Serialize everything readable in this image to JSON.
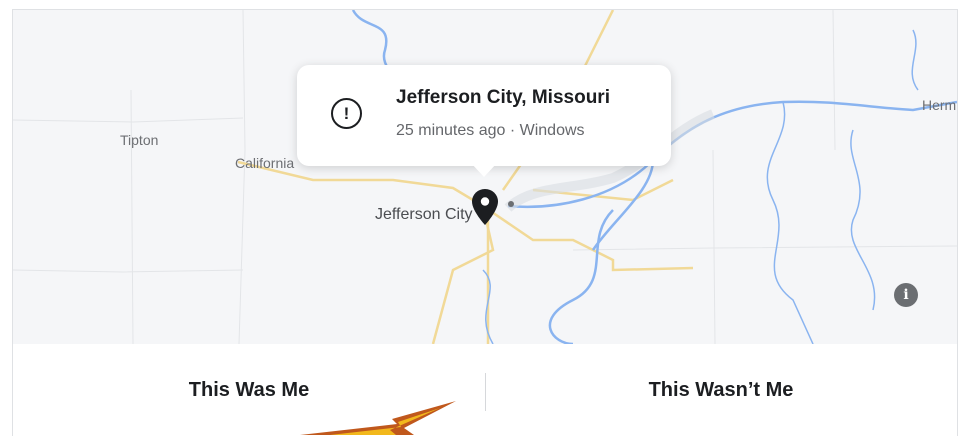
{
  "map": {
    "places": {
      "tipton": "Tipton",
      "california": "California",
      "jefferson_city": "Jefferson City",
      "herm": "Herm"
    },
    "info_glyph": "i"
  },
  "tooltip": {
    "icon": "!",
    "title": "Jefferson City, Missouri",
    "subtitle": "25 minutes ago · Windows"
  },
  "actions": {
    "confirm_label": "This Was Me",
    "deny_label": "This Wasn’t Me"
  },
  "colors": {
    "river": "#8ab4f0",
    "road": "#f1d997",
    "pin": "#1c1e21",
    "arrow": "#c0581c"
  }
}
